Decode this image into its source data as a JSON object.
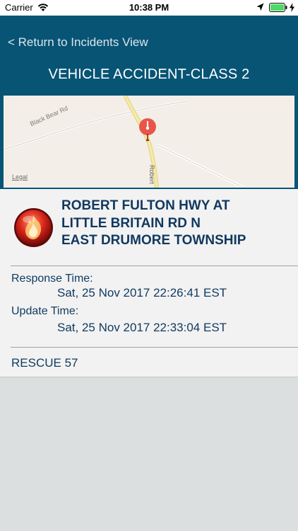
{
  "status_bar": {
    "carrier": "Carrier",
    "time": "10:38 PM"
  },
  "nav": {
    "back_label": "< Return to Incidents View",
    "title": "VEHICLE ACCIDENT-CLASS 2"
  },
  "map": {
    "roads": [
      "Black Bear Rd",
      "Robert"
    ],
    "legal_label": "Legal"
  },
  "incident": {
    "address_lines": [
      "ROBERT FULTON HWY  AT",
      "LITTLE BRITAIN RD N",
      "EAST DRUMORE TOWNSHIP"
    ],
    "response_time_label": "Response Time:",
    "response_time": "Sat, 25 Nov 2017 22:26:41 EST",
    "update_time_label": "Update Time:",
    "update_time": "Sat, 25 Nov 2017 22:33:04 EST",
    "unit": "RESCUE 57"
  },
  "colors": {
    "header": "#075475",
    "text": "#11385f",
    "pin": "#e8564a"
  }
}
